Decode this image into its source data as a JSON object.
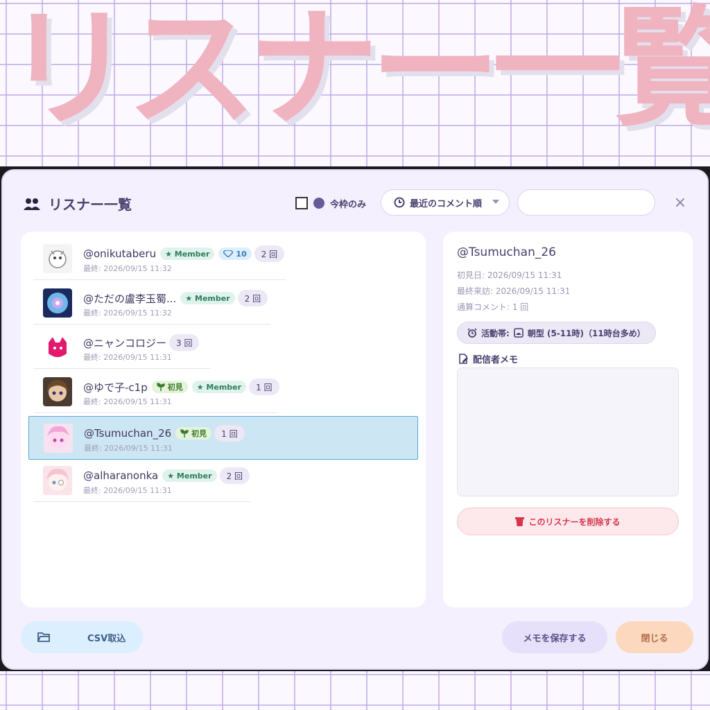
{
  "hero": {
    "title": "リスナー一覧"
  },
  "colors": {
    "accent": "#6a5a98",
    "selected_row": "#cde6f4",
    "delete": "#d8354d",
    "hero_pink": "#f0b3c0"
  },
  "header": {
    "title": "リスナー一覧",
    "only_current_label": "今枠のみ",
    "sort_label": "最近のコメント順",
    "search": {
      "value": "",
      "placeholder": ""
    },
    "icons": {
      "title": "people-icon",
      "sort": "clock-icon",
      "close": "close-icon"
    }
  },
  "listeners": [
    {
      "name": "@onikutaberu",
      "badges": [
        {
          "type": "member",
          "text": "★ Member"
        },
        {
          "type": "gem",
          "text": "10"
        }
      ],
      "count": "2 回",
      "last": "最終: 2026/09/15 11:32",
      "selected": false
    },
    {
      "name": "@ただの盧李玉蜀...",
      "badges": [
        {
          "type": "member",
          "text": "★ Member"
        }
      ],
      "count": "2 回",
      "last": "最終: 2026/09/15 11:32",
      "selected": false
    },
    {
      "name": "@ニャンコロジー",
      "badges": [],
      "count": "3 回",
      "last": "最終: 2026/09/15 11:31",
      "selected": false
    },
    {
      "name": "@ゆで子-c1p",
      "badges": [
        {
          "type": "first",
          "text": "初見"
        },
        {
          "type": "member",
          "text": "★ Member"
        }
      ],
      "count": "1 回",
      "last": "最終: 2026/09/15 11:31",
      "selected": false
    },
    {
      "name": "@Tsumuchan_26",
      "badges": [
        {
          "type": "first",
          "text": "初見"
        }
      ],
      "count": "1 回",
      "last": "最終: 2026/09/15 11:31",
      "selected": true
    },
    {
      "name": "@alharanonka",
      "badges": [
        {
          "type": "member",
          "text": "★ Member"
        }
      ],
      "count": "2 回",
      "last": "最終: 2026/09/15 11:31",
      "selected": false
    }
  ],
  "detail": {
    "name": "@Tsumuchan_26",
    "first_seen": "初見日: 2026/09/15 11:31",
    "last_visit": "最終来訪: 2026/09/15 11:31",
    "total_comments": "通算コメント: 1 回",
    "active_label": "活動帯:",
    "active_value": "朝型 (5-11時)（11時台多め）",
    "memo_label": "配信者メモ",
    "memo_value": "",
    "delete_label": "このリスナーを削除する"
  },
  "footer": {
    "csv_label": "CSV取込",
    "save_label": "メモを保存する",
    "close_label": "閉じる"
  }
}
